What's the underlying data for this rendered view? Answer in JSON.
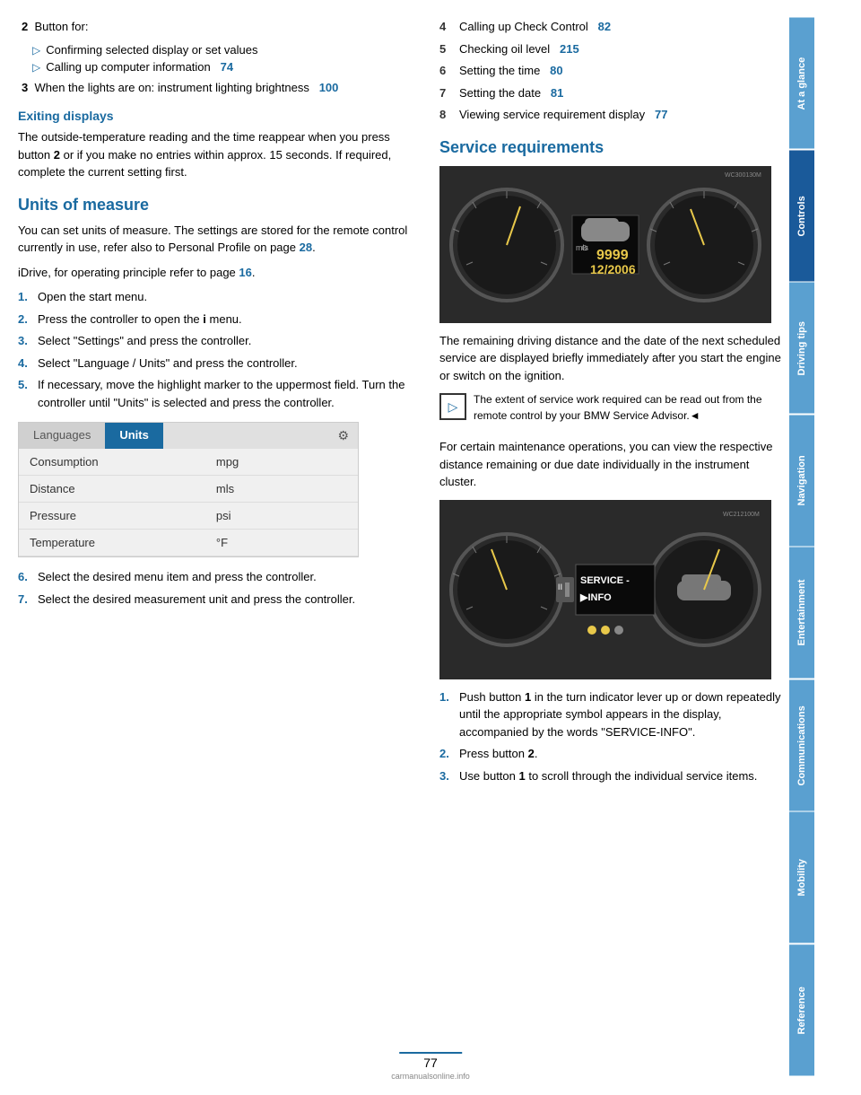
{
  "page": {
    "number": "77",
    "brand": "carmanualsonline.info"
  },
  "sidebar": {
    "tabs": [
      {
        "id": "at-a-glance",
        "label": "At a glance",
        "active": false
      },
      {
        "id": "controls",
        "label": "Controls",
        "active": true
      },
      {
        "id": "driving-tips",
        "label": "Driving tips",
        "active": false
      },
      {
        "id": "navigation",
        "label": "Navigation",
        "active": false
      },
      {
        "id": "entertainment",
        "label": "Entertainment",
        "active": false
      },
      {
        "id": "communications",
        "label": "Communications",
        "active": false
      },
      {
        "id": "mobility",
        "label": "Mobility",
        "active": false
      },
      {
        "id": "reference",
        "label": "Reference",
        "active": false
      }
    ]
  },
  "left": {
    "item2": {
      "label": "2",
      "intro": "Button for:",
      "bullets": [
        "Confirming selected display or set values",
        "Calling up computer information   74"
      ]
    },
    "item3": {
      "label": "3",
      "text": "When the lights are on: instrument lighting brightness",
      "pageref": "100"
    },
    "exiting": {
      "title": "Exiting displays",
      "body": "The outside-temperature reading and the time reappear when you press button",
      "bold2": "2",
      "body2": "or if you make no entries within approx. 15 seconds. If required, complete the current setting first."
    },
    "units": {
      "title": "Units of measure",
      "para1": "You can set units of measure. The settings are stored for the remote control currently in use, refer also to Personal Profile on page",
      "para1_ref": "28",
      "para1_end": ".",
      "para2": "iDrive, for operating principle refer to page",
      "para2_ref": "16",
      "para2_end": ".",
      "steps": [
        {
          "num": "1.",
          "text": "Open the start menu."
        },
        {
          "num": "2.",
          "text": "Press the controller to open the Ⓘ menu."
        },
        {
          "num": "3.",
          "text": "Select \"Settings\" and press the controller."
        },
        {
          "num": "4.",
          "text": "Select \"Language / Units\" and press the controller."
        },
        {
          "num": "5.",
          "text": "If necessary, move the highlight marker to the uppermost field. Turn the controller until \"Units\" is selected and press the controller."
        }
      ],
      "table": {
        "tabs": [
          "Languages",
          "Units"
        ],
        "active_tab": "Units",
        "rows": [
          {
            "label": "Consumption",
            "value": "mpg"
          },
          {
            "label": "Distance",
            "value": "mls"
          },
          {
            "label": "Pressure",
            "value": "psi"
          },
          {
            "label": "Temperature",
            "value": "°F"
          }
        ]
      },
      "steps2": [
        {
          "num": "6.",
          "text": "Select the desired menu item and press the controller."
        },
        {
          "num": "7.",
          "text": "Select the desired measurement unit and press the controller."
        }
      ]
    }
  },
  "right": {
    "list_items": [
      {
        "num": "4",
        "text": "Calling up Check Control",
        "ref": "82"
      },
      {
        "num": "5",
        "text": "Checking oil level",
        "ref": "215"
      },
      {
        "num": "6",
        "text": "Setting the time",
        "ref": "80"
      },
      {
        "num": "7",
        "text": "Setting the date",
        "ref": "81"
      },
      {
        "num": "8",
        "text": "Viewing service requirement display",
        "ref": "77"
      }
    ],
    "service_req": {
      "title": "Service requirements",
      "display1": {
        "mls": "mls",
        "number": "9999",
        "date": "12/2006"
      },
      "para1": "The remaining driving distance and the date of the next scheduled service are displayed briefly immediately after you start the engine or switch on the ignition.",
      "note": {
        "text": "The extent of service work required can be read out from the remote control by your BMW Service Advisor.◄"
      },
      "para2": "For certain maintenance operations, you can view the respective distance remaining or due date individually in the instrument cluster.",
      "display2": {
        "line1": "SERVICE -",
        "line2": "▶INFO"
      },
      "steps": [
        {
          "num": "1.",
          "text": "Push button 1 in the turn indicator lever up or down repeatedly until the appropriate symbol appears in the display, accompanied by the words \"SERVICE-INFO\"."
        },
        {
          "num": "2.",
          "text": "Press button 2."
        },
        {
          "num": "3.",
          "text": "Use button 1 to scroll through the individual service items."
        }
      ],
      "steps_bold": {
        "s1_b1": "1",
        "s2_b2": "2",
        "s3_b1": "1"
      }
    }
  }
}
